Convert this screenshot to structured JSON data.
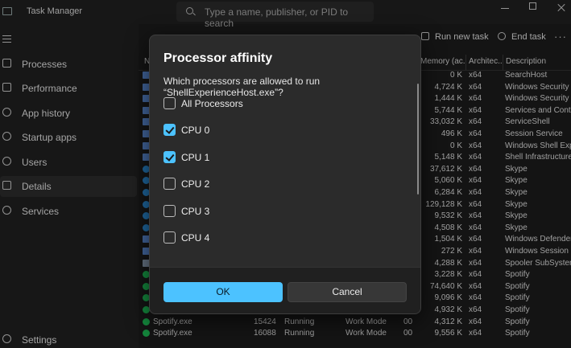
{
  "app": {
    "title": "Task Manager"
  },
  "search": {
    "placeholder": "Type a name, publisher, or PID to search"
  },
  "sidebar": {
    "items": [
      {
        "label": "Processes"
      },
      {
        "label": "Performance"
      },
      {
        "label": "App history"
      },
      {
        "label": "Startup apps"
      },
      {
        "label": "Users"
      },
      {
        "label": "Details"
      },
      {
        "label": "Services"
      }
    ],
    "settings_label": "Settings"
  },
  "toolbar": {
    "run_new_task": "Run new task",
    "end_task": "End task",
    "more": "···"
  },
  "table": {
    "columns": {
      "name": "N",
      "memory": "Memory (ac...",
      "architecture": "Architec...",
      "description": "Description"
    },
    "rows": [
      {
        "name": "",
        "pid": "",
        "status": "",
        "user": "",
        "cpu": "",
        "memory": "0 K",
        "arch": "x64",
        "desc": "SearchHost",
        "icon": "app-icon"
      },
      {
        "name": "",
        "pid": "",
        "status": "",
        "user": "",
        "cpu": "",
        "memory": "4,724 K",
        "arch": "x64",
        "desc": "Windows Security H",
        "icon": "app-icon"
      },
      {
        "name": "",
        "pid": "",
        "status": "",
        "user": "",
        "cpu": "",
        "memory": "1,444 K",
        "arch": "x64",
        "desc": "Windows Security n",
        "icon": "shield-icon"
      },
      {
        "name": "",
        "pid": "",
        "status": "",
        "user": "",
        "cpu": "",
        "memory": "5,744 K",
        "arch": "x64",
        "desc": "Services and Contro",
        "icon": "app-icon"
      },
      {
        "name": "",
        "pid": "",
        "status": "",
        "user": "",
        "cpu": "",
        "memory": "33,032 K",
        "arch": "x64",
        "desc": "ServiceShell",
        "icon": "app-icon"
      },
      {
        "name": "",
        "pid": "",
        "status": "",
        "user": "",
        "cpu": "",
        "memory": "496 K",
        "arch": "x64",
        "desc": "Session  Service",
        "icon": "app-icon"
      },
      {
        "name": "",
        "pid": "",
        "status": "",
        "user": "",
        "cpu": "",
        "memory": "0 K",
        "arch": "x64",
        "desc": "Windows Shell Exp",
        "icon": "app-icon"
      },
      {
        "name": "",
        "pid": "",
        "status": "",
        "user": "",
        "cpu": "",
        "memory": "5,148 K",
        "arch": "x64",
        "desc": "Shell Infrastructure",
        "icon": "app-icon"
      },
      {
        "name": "",
        "pid": "",
        "status": "",
        "user": "",
        "cpu": "",
        "memory": "37,612 K",
        "arch": "x64",
        "desc": "Skype",
        "icon": "skype-icon"
      },
      {
        "name": "",
        "pid": "",
        "status": "",
        "user": "",
        "cpu": "",
        "memory": "5,060 K",
        "arch": "x64",
        "desc": "Skype",
        "icon": "skype-icon"
      },
      {
        "name": "",
        "pid": "",
        "status": "",
        "user": "",
        "cpu": "",
        "memory": "6,284 K",
        "arch": "x64",
        "desc": "Skype",
        "icon": "skype-icon"
      },
      {
        "name": "",
        "pid": "",
        "status": "",
        "user": "",
        "cpu": "",
        "memory": "129,128 K",
        "arch": "x64",
        "desc": "Skype",
        "icon": "skype-icon"
      },
      {
        "name": "",
        "pid": "",
        "status": "",
        "user": "",
        "cpu": "",
        "memory": "9,532 K",
        "arch": "x64",
        "desc": "Skype",
        "icon": "skype-icon"
      },
      {
        "name": "",
        "pid": "",
        "status": "",
        "user": "",
        "cpu": "",
        "memory": "4,508 K",
        "arch": "x64",
        "desc": "Skype",
        "icon": "skype-icon"
      },
      {
        "name": "",
        "pid": "",
        "status": "",
        "user": "",
        "cpu": "",
        "memory": "1,504 K",
        "arch": "x64",
        "desc": "Windows Defender",
        "icon": "app-icon"
      },
      {
        "name": "",
        "pid": "",
        "status": "",
        "user": "",
        "cpu": "",
        "memory": "272 K",
        "arch": "x64",
        "desc": "Windows Session M",
        "icon": "app-icon"
      },
      {
        "name": "",
        "pid": "",
        "status": "",
        "user": "",
        "cpu": "",
        "memory": "4,288 K",
        "arch": "x64",
        "desc": "Spooler SubSystem",
        "icon": "printer-icon"
      },
      {
        "name": "",
        "pid": "",
        "status": "",
        "user": "",
        "cpu": "",
        "memory": "3,228 K",
        "arch": "x64",
        "desc": "Spotify",
        "icon": "spotify-icon"
      },
      {
        "name": "",
        "pid": "",
        "status": "",
        "user": "",
        "cpu": "",
        "memory": "74,640 K",
        "arch": "x64",
        "desc": "Spotify",
        "icon": "spotify-icon"
      },
      {
        "name": "",
        "pid": "",
        "status": "",
        "user": "",
        "cpu": "",
        "memory": "9,096 K",
        "arch": "x64",
        "desc": "Spotify",
        "icon": "spotify-icon"
      },
      {
        "name": "",
        "pid": "",
        "status": "",
        "user": "",
        "cpu": "",
        "memory": "4,932 K",
        "arch": "x64",
        "desc": "Spotify",
        "icon": "spotify-icon"
      },
      {
        "name": "Spotify.exe",
        "pid": "15424",
        "status": "Running",
        "user": "Work Mode",
        "cpu": "00",
        "memory": "4,312 K",
        "arch": "x64",
        "desc": "Spotify",
        "icon": "spotify-icon"
      },
      {
        "name": "Spotify.exe",
        "pid": "16088",
        "status": "Running",
        "user": "Work Mode",
        "cpu": "00",
        "memory": "9,556 K",
        "arch": "x64",
        "desc": "Spotify",
        "icon": "spotify-icon"
      }
    ]
  },
  "dialog": {
    "title": "Processor affinity",
    "question": "Which processors are allowed to run “ShellExperienceHost.exe”?",
    "options": [
      {
        "label": "All Processors",
        "checked": false
      },
      {
        "label": "CPU 0",
        "checked": true
      },
      {
        "label": "CPU 1",
        "checked": true
      },
      {
        "label": "CPU 2",
        "checked": false
      },
      {
        "label": "CPU 3",
        "checked": false
      },
      {
        "label": "CPU 4",
        "checked": false
      }
    ],
    "ok_label": "OK",
    "cancel_label": "Cancel"
  },
  "colors": {
    "accent": "#4cc2ff",
    "background": "#1c1c1c",
    "dialog": "#2b2b2b"
  }
}
